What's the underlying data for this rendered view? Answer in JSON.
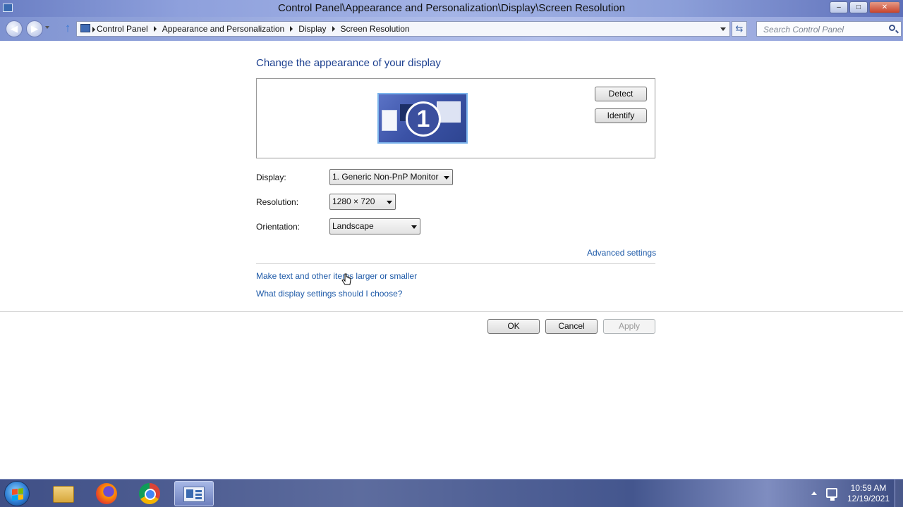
{
  "window": {
    "title": "Control Panel\\Appearance and Personalization\\Display\\Screen Resolution",
    "minimize": "–",
    "maximize": "□",
    "close": "✕"
  },
  "address": {
    "crumbs": [
      "Control Panel",
      "Appearance and Personalization",
      "Display",
      "Screen Resolution"
    ],
    "search_placeholder": "Search Control Panel"
  },
  "main": {
    "heading": "Change the appearance of your display",
    "monitor_number": "1",
    "detect_label": "Detect",
    "identify_label": "Identify",
    "display_label": "Display:",
    "display_value": "1. Generic Non-PnP Monitor",
    "resolution_label": "Resolution:",
    "resolution_value": "1280 × 720",
    "orientation_label": "Orientation:",
    "orientation_value": "Landscape",
    "advanced_settings": "Advanced settings",
    "link_text_size": "Make text and other items larger or smaller",
    "link_help": "What display settings should I choose?"
  },
  "footer": {
    "ok": "OK",
    "cancel": "Cancel",
    "apply": "Apply"
  },
  "taskbar": {
    "time": "10:59 AM",
    "date": "12/19/2021",
    "items": [
      "windows-explorer-icon",
      "firefox-icon",
      "chrome-icon",
      "control-panel-icon"
    ]
  }
}
